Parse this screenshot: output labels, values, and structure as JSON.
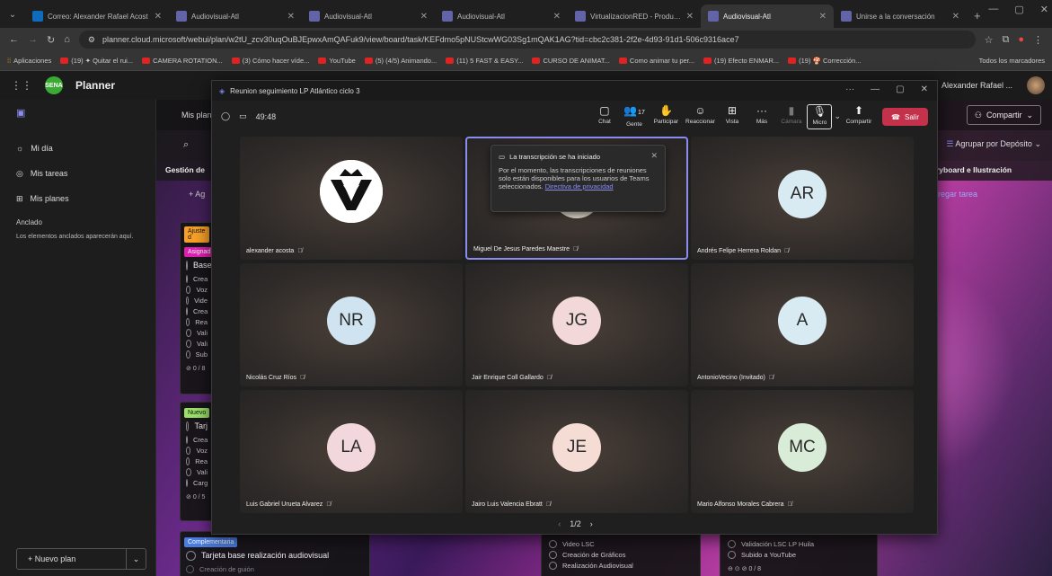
{
  "browser": {
    "tabs": [
      {
        "title": "Correo: Alexander Rafael Acost",
        "color": "#0f6cbd",
        "active": false
      },
      {
        "title": "Audiovisual-Atl",
        "color": "#6264a7",
        "active": false
      },
      {
        "title": "Audiovisual-Atl",
        "color": "#6264a7",
        "active": false
      },
      {
        "title": "Audiovisual-Atl",
        "color": "#6264a7",
        "active": false
      },
      {
        "title": "VirtualizacionRED - Producción",
        "color": "#6264a7",
        "active": false
      },
      {
        "title": "Audiovisual-Atl",
        "color": "#6264a7",
        "active": true
      },
      {
        "title": "Unirse a la conversación",
        "color": "#6264a7",
        "active": false
      }
    ],
    "url": "planner.cloud.microsoft/webui/plan/w2tU_zcv30uqOuBJEpwxAmQAFuk9/view/board/task/KEFdmo5pNUStcwWG03Sg1mQAK1AG?tid=cbc2c381-2f2e-4d93-91d1-506c9316ace7",
    "bookmarks": [
      "Aplicaciones",
      "(19) ✦ Quitar el rui...",
      "CAMERA ROTATION...",
      "(3) Cómo hacer víde...",
      "YouTube",
      "(5) (4/5) Animando...",
      "(11) 5 FAST & EASY...",
      "CURSO DE ANIMAT...",
      "Como animar tu per...",
      "(19) Efecto ENMAR...",
      "(19) 🍄 Corrección..."
    ],
    "bookmarks_all": "Todos los marcadores"
  },
  "planner": {
    "app_name": "Planner",
    "user": "Alexander Rafael ...",
    "help": "?",
    "sidebar": {
      "items": [
        {
          "label": "Mi día",
          "icon": "sun-icon"
        },
        {
          "label": "Mis tareas",
          "icon": "person-icon"
        },
        {
          "label": "Mis planes",
          "icon": "grid-icon"
        }
      ],
      "pinned_title": "Anclado",
      "pinned_note": "Los elementos anclados aparecerán aquí.",
      "new_plan": "Nuevo plan"
    },
    "board": {
      "plan_label": "Mis plane",
      "share": "Compartir",
      "group_by": "Agrupar por Depósito",
      "col_left": "Gestión de",
      "col_right": "ryboard e Ilustración",
      "add_task_left": "+ Ag",
      "add_task_right": "regar tarea",
      "tag_ajuste": "Ajuste d",
      "tag_asignad": "Asignad",
      "card1_title": "Base",
      "card1_items": [
        "Crea",
        "Voz",
        "Vide",
        "Crea",
        "Rea",
        "Vali",
        "Vali",
        "Sub"
      ],
      "card1_count": "0 / 8",
      "tag_nuevo": "Nuevo",
      "card2_title": "Tarj",
      "card2_items": [
        "Crea",
        "Voz",
        "Rea",
        "Vali",
        "Carg"
      ],
      "card2_count": "0 / 5",
      "tag_comp": "Complementaria",
      "card3_title": "Tarjeta base realización audiovisual",
      "card3_sub": "Creación de guión",
      "mid_items": [
        "Video LSC",
        "Creación de Gráficos",
        "Realización Audiovisual"
      ],
      "right_items": [
        "Validación LSC LP Huila",
        "Subido a YouTube"
      ],
      "right_count": "0 / 8"
    }
  },
  "teams": {
    "window_title": "Reunion seguimiento LP Atlántico ciclo 3",
    "timer": "49:48",
    "controls": [
      {
        "label": "Chat",
        "icon": "chat-icon",
        "glyph": "▢"
      },
      {
        "label": "Gente",
        "icon": "people-icon",
        "glyph": "👥",
        "count": "17"
      },
      {
        "label": "Participar",
        "icon": "hand-icon",
        "glyph": "✋"
      },
      {
        "label": "Reaccionar",
        "icon": "smile-icon",
        "glyph": "☺"
      },
      {
        "label": "Vista",
        "icon": "view-icon",
        "glyph": "⊞"
      },
      {
        "label": "Más",
        "icon": "more-icon",
        "glyph": "···"
      },
      {
        "label": "Cámara",
        "icon": "camera-off-icon",
        "glyph": "▮"
      },
      {
        "label": "Micro",
        "icon": "mic-off-icon",
        "glyph": "🎙"
      },
      {
        "label": "Compartir",
        "icon": "share-screen-icon",
        "glyph": "⬆"
      }
    ],
    "leave": "Salir",
    "toast": {
      "title": "La transcripción se ha iniciado",
      "body": "Por el momento, las transcripciones de reuniones solo están disponibles para los usuarios de Teams seleccionados.",
      "link": "Directiva de privacidad"
    },
    "participants": [
      {
        "name": "alexander acosta",
        "initials": "",
        "color": "#ffffff",
        "logo": true,
        "speaking": false
      },
      {
        "name": "Miguel De Jesus Paredes Maestre",
        "initials": "",
        "color": "#e8e0d0",
        "logo": false,
        "speaking": true
      },
      {
        "name": "Andrés Felipe Herrera Roldan",
        "initials": "AR",
        "color": "#d8eaf2",
        "logo": false,
        "speaking": false
      },
      {
        "name": "Nicolás Cruz Ríos",
        "initials": "NR",
        "color": "#cfe4f0",
        "logo": false,
        "speaking": false
      },
      {
        "name": "Jair Enrique Coll Gallardo",
        "initials": "JG",
        "color": "#f2d8d8",
        "logo": false,
        "speaking": false
      },
      {
        "name": "AntonioVecino (Invitado)",
        "initials": "A",
        "color": "#d8eaf2",
        "logo": false,
        "speaking": false
      },
      {
        "name": "Luis Gabriel Urueta Alvarez",
        "initials": "LA",
        "color": "#f2d8dc",
        "logo": false,
        "speaking": false
      },
      {
        "name": "Jairo Luis Valencia Ebratt",
        "initials": "JE",
        "color": "#f5ddd6",
        "logo": false,
        "speaking": false
      },
      {
        "name": "Mario Alfonso Morales Cabrera",
        "initials": "MC",
        "color": "#d8ecd8",
        "logo": false,
        "speaking": false
      }
    ],
    "pager": "1/2"
  }
}
